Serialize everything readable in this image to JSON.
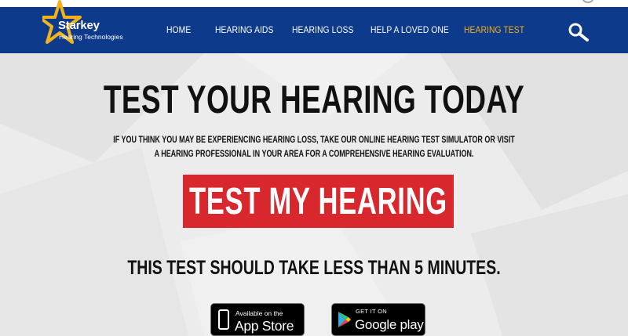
{
  "brand": {
    "name": "Starkey",
    "tagline": "Hearing Technologies",
    "colors": {
      "navy": "#0d3a8a",
      "gold": "#f2b21b",
      "red": "#d8272d"
    }
  },
  "nav": {
    "items": [
      {
        "label": "HOME",
        "active": false
      },
      {
        "label": "HEARING AIDS",
        "active": false
      },
      {
        "label": "HEARING LOSS",
        "active": false
      },
      {
        "label": "HELP A LOVED ONE",
        "active": false
      },
      {
        "label": "HEARING TEST",
        "active": true
      }
    ],
    "search_icon": "search-icon"
  },
  "hero": {
    "title": "TEST YOUR HEARING TODAY",
    "description_line1": "IF YOU THINK YOU MAY BE EXPERIENCING HEARING LOSS, TAKE OUR ONLINE HEARING TEST SIMULATOR OR VISIT",
    "description_line2": "A HEARING PROFESSIONAL IN YOUR AREA FOR A COMPREHENSIVE HEARING EVALUATION.",
    "cta_label": "TEST MY HEARING",
    "duration_note": "THIS TEST SHOULD TAKE LESS THAN 5 MINUTES."
  },
  "badges": {
    "apple": {
      "small": "Available on the",
      "large": "App Store",
      "icon": "phone-icon"
    },
    "google": {
      "small": "GET IT ON",
      "large": "Google play",
      "icon": "google-play-icon"
    }
  }
}
